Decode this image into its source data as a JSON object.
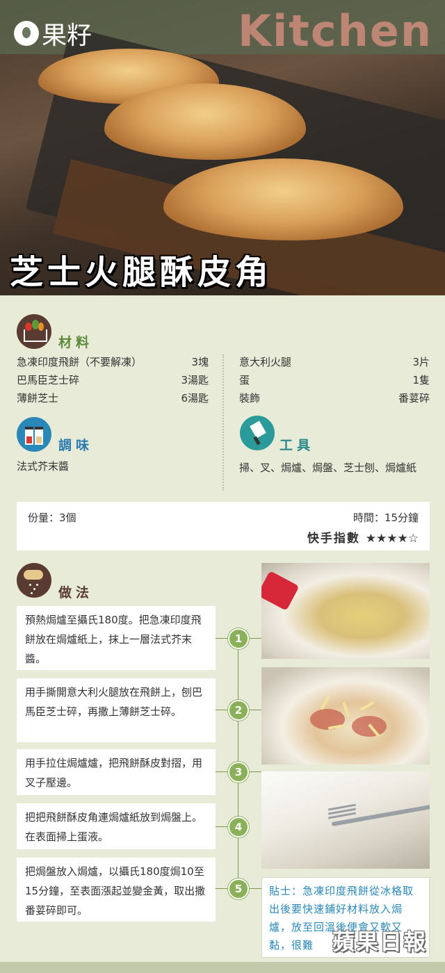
{
  "header": {
    "logo_text": "果籽",
    "brand_word": "Kitchen",
    "dish_title": "芝士火腿酥皮角"
  },
  "ingredients": {
    "title": "材料",
    "left": [
      {
        "name": "急凍印度飛餅（不要解凍）",
        "qty": "3塊"
      },
      {
        "name": "巴馬臣芝士碎",
        "qty": "3湯匙"
      },
      {
        "name": "薄餅芝士",
        "qty": "6湯匙"
      }
    ],
    "right": [
      {
        "name": "意大利火腿",
        "qty": "3片"
      },
      {
        "name": "蛋",
        "qty": "1隻"
      },
      {
        "name": "裝飾",
        "qty": "番荽碎"
      }
    ]
  },
  "seasoning": {
    "title": "調味",
    "text": "法式芥末醬"
  },
  "tools": {
    "title": "工具",
    "text": "掃、叉、焗爐、焗盤、芝士刨、焗爐紙"
  },
  "info": {
    "servings": "份量：3個",
    "time": "時間：15分鐘",
    "quick_label": "快手指數",
    "quick_stars": "★★★★☆"
  },
  "method": {
    "title": "做法",
    "steps": [
      {
        "num": "1",
        "text": "預熱焗爐至攝氏180度。把急凍印度飛餅放在焗爐紙上，抹上一層法式芥末醬。"
      },
      {
        "num": "2",
        "text": "用手撕開意大利火腿放在飛餅上，刨巴馬臣芝士碎，再撒上薄餅芝士碎。"
      },
      {
        "num": "3",
        "text": "用手拉住焗爐爐，把飛餅酥皮對摺，用叉子壓邊。"
      },
      {
        "num": "4",
        "text": "把把飛餅酥皮角連焗爐紙放到焗盤上。在表面掃上蛋液。"
      },
      {
        "num": "5",
        "text": "把焗盤放入焗爐，以攝氏180度焗10至15分鐘，至表面漲起並變金黃，取出撒番荽碎即可。"
      }
    ]
  },
  "tip": {
    "text": "貼士：急凍印度飛餅從冰格取出後要快速鋪好材料放入焗爐，放至回溫後便會又軟又黏，很難"
  },
  "watermark": "蘋果日報",
  "colors": {
    "background": "#e9ebd9",
    "ingredients_accent": "#5b8a3a",
    "seasoning_accent": "#2a7bb0",
    "tools_accent": "#2a8a8a",
    "method_accent": "#5a3b32",
    "step_number": "#8bb05a",
    "tip_text": "#2a88b8",
    "title_text": "#ffffff"
  },
  "icons": [
    "vegetable-basket-icon",
    "spice-jars-icon",
    "cleaver-icon",
    "sprinkle-hand-icon"
  ]
}
